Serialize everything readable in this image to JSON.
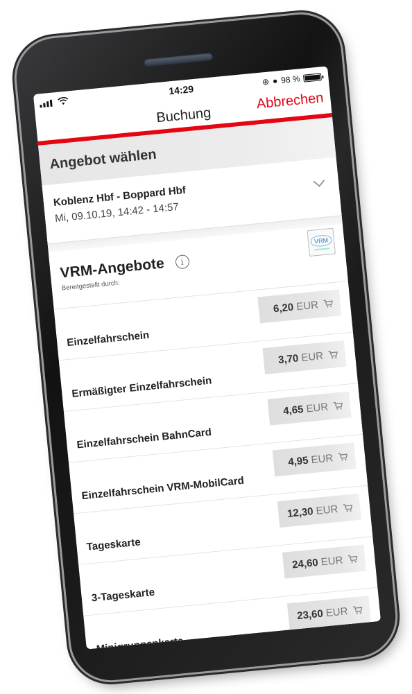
{
  "status_bar": {
    "time": "14:29",
    "battery": "98 %",
    "battery_level": 0.98
  },
  "nav": {
    "title": "Buchung",
    "cancel_label": "Abbrechen"
  },
  "section": {
    "title": "Angebot wählen"
  },
  "connection": {
    "route": "Koblenz Hbf - Boppard Hbf",
    "when": "Mi, 09.10.19, 14:42 - 14:57"
  },
  "provider": {
    "name": "VRM-Angebote",
    "provided_by": "Bereitgestellt durch:",
    "logo_text": "VRM"
  },
  "offers": [
    {
      "label": "Einzelfahrschein",
      "amount": "6,20",
      "currency": "EUR"
    },
    {
      "label": "Ermäßigter Einzelfahrschein",
      "amount": "3,70",
      "currency": "EUR"
    },
    {
      "label": "Einzelfahrschein BahnCard",
      "amount": "4,65",
      "currency": "EUR"
    },
    {
      "label": "Einzelfahrschein VRM-MobilCard",
      "amount": "4,95",
      "currency": "EUR"
    },
    {
      "label": "Tageskarte",
      "amount": "12,30",
      "currency": "EUR"
    },
    {
      "label": "3-Tageskarte",
      "amount": "24,60",
      "currency": "EUR"
    },
    {
      "label": "Minigruppenkarte",
      "amount": "23,60",
      "currency": "EUR"
    }
  ],
  "colors": {
    "accent": "#e30613",
    "phone": "#161617"
  },
  "icons": {
    "cart": "shopping-cart-icon",
    "chevron": "chevron-down-icon",
    "info": "info-icon"
  }
}
